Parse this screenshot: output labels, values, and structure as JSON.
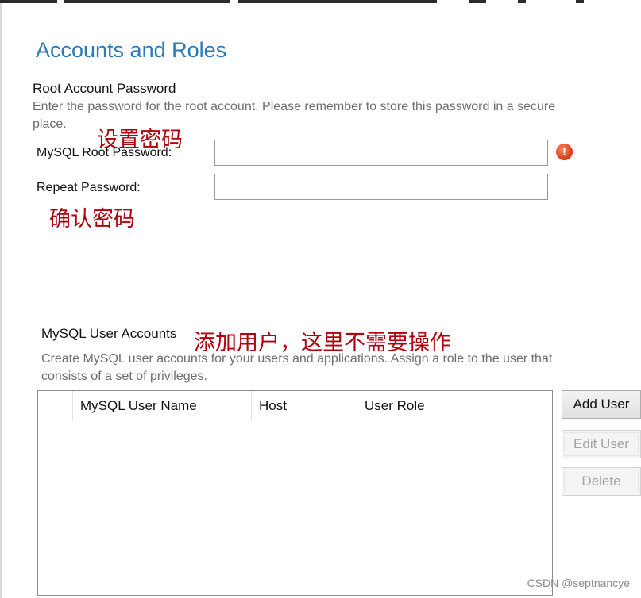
{
  "page": {
    "title": "Accounts and Roles"
  },
  "root_account": {
    "heading": "Root Account Password",
    "description_line1": "Enter the password for the root account.  Please remember to store this password in a secure",
    "description_line2": "place.",
    "root_password_label": "MySQL Root Password:",
    "root_password_value": "",
    "repeat_password_label": "Repeat Password:",
    "repeat_password_value": "",
    "error_icon_glyph": "!"
  },
  "annotations": {
    "set_password": "设置密码",
    "confirm_password": "确认密码",
    "add_user_note": "添加用户，这里不需要操作"
  },
  "user_accounts": {
    "heading": "MySQL User Accounts",
    "description_line1": "Create MySQL user accounts for your users and applications. Assign a role to the user that",
    "description_line2": "consists of a set of privileges.",
    "columns": [
      "MySQL User Name",
      "Host",
      "User Role"
    ],
    "rows": []
  },
  "buttons": {
    "add_user": "Add User",
    "edit_user": "Edit User",
    "delete": "Delete"
  },
  "watermark": "CSDN @septnancye",
  "colors": {
    "title": "#2c7ab8",
    "annotation": "#b3000f",
    "error_icon": "#d9361a"
  }
}
